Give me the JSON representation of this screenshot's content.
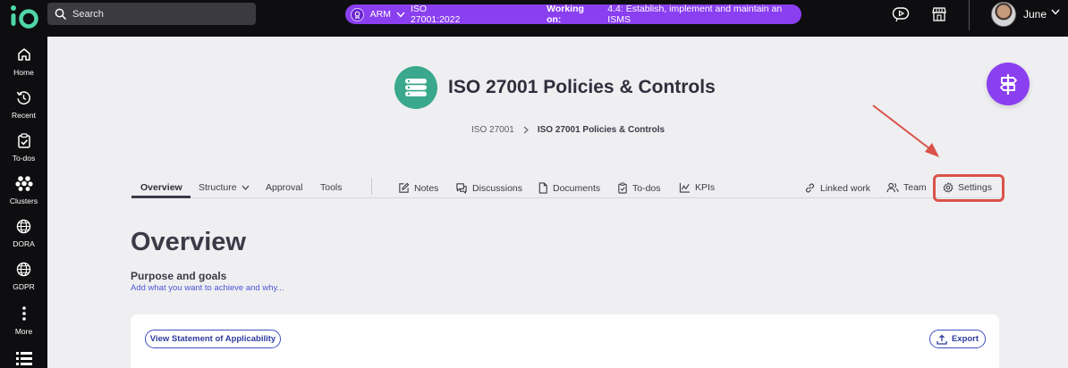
{
  "topbar": {
    "search_label": "Search",
    "context": {
      "app": "ARM",
      "standard": "ISO 27001:2022",
      "working_label": "Working on:",
      "task": "4.4: Establish, implement and maintain an ISMS",
      "color": "#8a3ff0"
    },
    "user_name": "June"
  },
  "sidebar": {
    "items": [
      {
        "label": "Home",
        "icon": "home-icon"
      },
      {
        "label": "Recent",
        "icon": "history-icon"
      },
      {
        "label": "To-dos",
        "icon": "clipboard-check-icon"
      },
      {
        "label": "Clusters",
        "icon": "clusters-icon"
      },
      {
        "label": "DORA",
        "icon": "globe-icon"
      },
      {
        "label": "GDPR",
        "icon": "globe-icon"
      },
      {
        "label": "More",
        "icon": "more-vertical-icon"
      }
    ]
  },
  "header": {
    "title": "ISO 27001 Policies & Controls",
    "icon": "server-stack-icon",
    "icon_color": "#3aa88d"
  },
  "breadcrumb": {
    "items": [
      "ISO 27001",
      "ISO 27001 Policies & Controls"
    ]
  },
  "tabs": {
    "left": [
      "Overview",
      "Structure",
      "Approval",
      "Tools"
    ],
    "middle": [
      "Notes",
      "Discussions",
      "Documents",
      "To-dos",
      "KPIs"
    ],
    "right": [
      "Linked work",
      "Team",
      "Settings"
    ],
    "active": "Overview"
  },
  "main": {
    "heading": "Overview",
    "purpose_title": "Purpose and goals",
    "purpose_prompt": "Add what you want to achieve and why...",
    "soa_button": "View Statement of Applicability",
    "export_button": "Export"
  },
  "annotation": {
    "color": "#d9534a",
    "target": "Settings"
  }
}
